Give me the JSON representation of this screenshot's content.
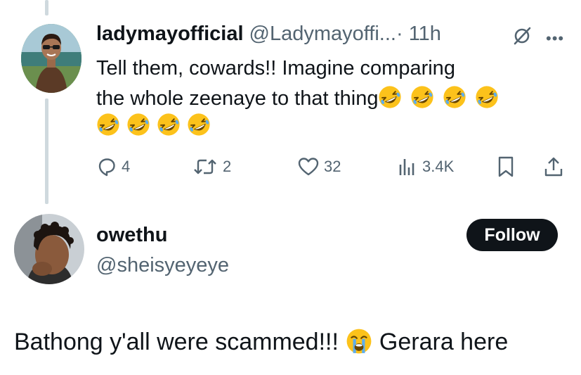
{
  "tweet1": {
    "display_name": "ladymayofficial",
    "handle": "@Ladymayoffi...",
    "time": "· 11h",
    "text_line1": "Tell them, cowards!! Imagine comparing",
    "text_line2": "the whole zeenaye to that thing",
    "emoji": "rolling-on-floor-laughing-emoji",
    "emoji_count_line2": 4,
    "emoji_count_line3": 4,
    "actions": {
      "replies": "4",
      "reposts": "2",
      "likes": "32",
      "views": "3.4K"
    },
    "icons": [
      "grok-icon",
      "more-icon",
      "reply-icon",
      "repost-icon",
      "like-icon",
      "views-icon",
      "bookmark-icon",
      "share-icon"
    ]
  },
  "tweet2": {
    "display_name": "owethu",
    "handle": "@sheisyeyeye",
    "follow_label": "Follow",
    "text_before": "Bathong y'all were scammed!!!",
    "emoji": "loudly-crying-face-emoji",
    "text_after": "Gerara here"
  },
  "colors": {
    "text": "#0f1419",
    "secondary": "#536471",
    "thread_line": "#cfd9de",
    "follow_bg": "#0f1419",
    "emoji_yellow": "#fcc21b"
  }
}
